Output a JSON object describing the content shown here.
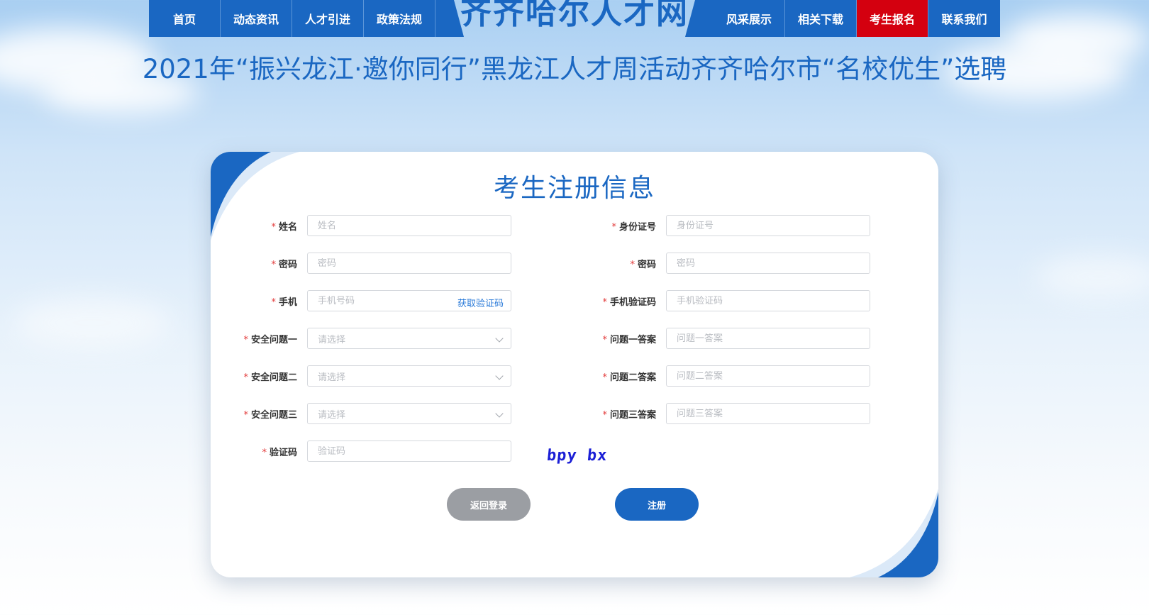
{
  "nav": {
    "left_items": [
      "首页",
      "动态资讯",
      "人才引进",
      "政策法规"
    ],
    "right_items": [
      "风采展示",
      "相关下载",
      "考生报名",
      "联系我们"
    ],
    "active_item": "考生报名",
    "site_title": "齐齐哈尔人才网"
  },
  "event_title": "2021年“振兴龙江·邀你同行”黑龙江人才周活动齐齐哈尔市“名校优生”选聘",
  "form": {
    "title": "考生注册信息",
    "left_fields": [
      {
        "label": "姓名",
        "placeholder": "姓名",
        "type": "text"
      },
      {
        "label": "密码",
        "placeholder": "密码",
        "type": "password"
      },
      {
        "label": "手机",
        "placeholder": "手机号码",
        "type": "text",
        "action": "获取验证码"
      },
      {
        "label": "安全问题一",
        "placeholder": "请选择",
        "type": "select"
      },
      {
        "label": "安全问题二",
        "placeholder": "请选择",
        "type": "select"
      },
      {
        "label": "安全问题三",
        "placeholder": "请选择",
        "type": "select"
      },
      {
        "label": "验证码",
        "placeholder": "验证码",
        "type": "text"
      }
    ],
    "right_fields": [
      {
        "label": "身份证号",
        "placeholder": "身份证号"
      },
      {
        "label": "密码",
        "placeholder": "密码"
      },
      {
        "label": "手机验证码",
        "placeholder": "手机验证码"
      },
      {
        "label": "问题一答案",
        "placeholder": "问题一答案"
      },
      {
        "label": "问题二答案",
        "placeholder": "问题二答案"
      },
      {
        "label": "问题三答案",
        "placeholder": "问题三答案"
      }
    ],
    "required_mark": "*",
    "captcha_text": "bpy bx",
    "back_button": "返回登录",
    "register_button": "注册"
  },
  "colors": {
    "primary": "#1a67c2",
    "active_nav": "#d4000f",
    "back_button": "#9b9ea3",
    "captcha": "#1b1fd6",
    "required": "#e23b3b"
  }
}
